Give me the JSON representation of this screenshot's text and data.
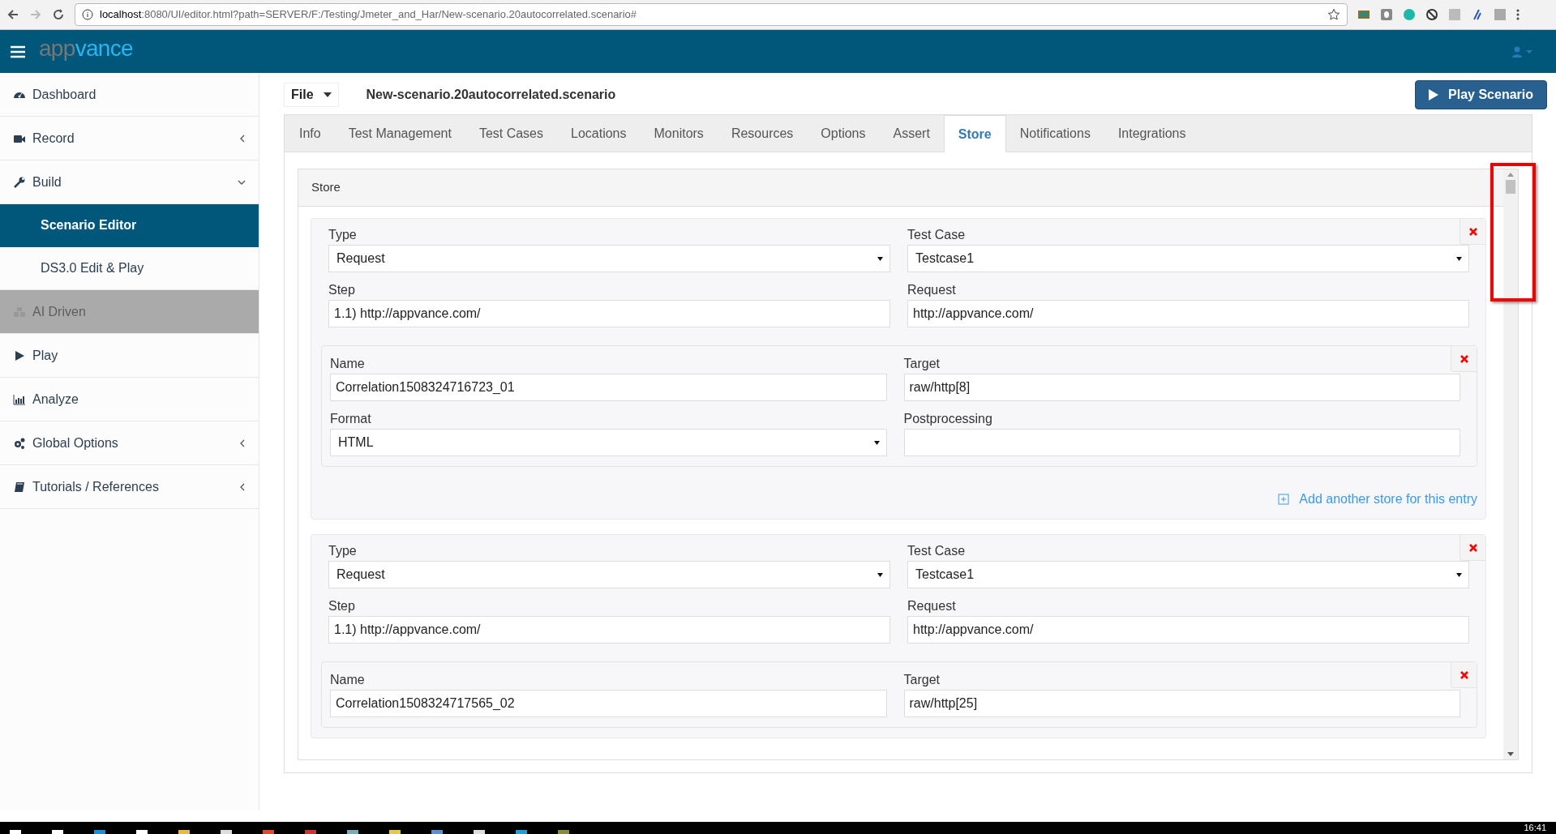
{
  "browser": {
    "url_host": "localhost",
    "url_rest": ":8080/UI/editor.html?path=SERVER/F:/Testing/Jmeter_and_Har/New-scenario.20autocorrelated.scenario#"
  },
  "header": {
    "logo_parts": [
      "app",
      "vance"
    ]
  },
  "sidebar": {
    "items": [
      {
        "label": "Dashboard",
        "kind": "dashboard",
        "has_submenu": false,
        "disabled": false
      },
      {
        "label": "Record",
        "kind": "video",
        "has_submenu": true,
        "expanded": false,
        "disabled": false
      },
      {
        "label": "Build",
        "kind": "wrench",
        "has_submenu": true,
        "disabled": false,
        "expanded": true,
        "children": [
          {
            "label": "Scenario Editor",
            "selected": true
          },
          {
            "label": "DS3.0 Edit & Play",
            "selected": false
          }
        ]
      },
      {
        "label": "AI Driven",
        "kind": "cubes",
        "has_submenu": false,
        "disabled": true
      },
      {
        "label": "Play",
        "kind": "play",
        "has_submenu": false,
        "disabled": false
      },
      {
        "label": "Analyze",
        "kind": "chart",
        "has_submenu": false,
        "disabled": false
      },
      {
        "label": "Global Options",
        "kind": "gears",
        "has_submenu": true,
        "expanded": false,
        "disabled": false
      },
      {
        "label": "Tutorials / References",
        "kind": "book",
        "has_submenu": true,
        "expanded": false,
        "disabled": false
      }
    ]
  },
  "toolbar": {
    "file_menu": "File",
    "scenario_title": "New-scenario.20autocorrelated.scenario",
    "play_button": "Play Scenario"
  },
  "tabs": [
    {
      "label": "Info",
      "selected": false
    },
    {
      "label": "Test Management",
      "selected": false
    },
    {
      "label": "Test Cases",
      "selected": false
    },
    {
      "label": "Locations",
      "selected": false
    },
    {
      "label": "Monitors",
      "selected": false
    },
    {
      "label": "Resources",
      "selected": false
    },
    {
      "label": "Options",
      "selected": false
    },
    {
      "label": "Assert",
      "selected": false
    },
    {
      "label": "Store",
      "selected": true
    },
    {
      "label": "Notifications",
      "selected": false
    },
    {
      "label": "Integrations",
      "selected": false
    }
  ],
  "store_panel": {
    "title": "Store",
    "entries": [
      {
        "fields": [
          {
            "label": "Type",
            "kind": "select",
            "value": "Request"
          },
          {
            "label": "Test Case",
            "kind": "select",
            "value": "Testcase1"
          },
          {
            "label": "Step",
            "kind": "input",
            "value": "1.1) http://appvance.com/"
          },
          {
            "label": "Request",
            "kind": "input",
            "value": "http://appvance.com/"
          }
        ],
        "stores": [
          {
            "fields": [
              {
                "label": "Name",
                "kind": "input",
                "value": "Correlation1508324716723_01"
              },
              {
                "label": "Target",
                "kind": "input",
                "value": "raw/http[8]"
              },
              {
                "label": "Format",
                "kind": "select",
                "value": "HTML"
              },
              {
                "label": "Postprocessing",
                "kind": "input"
              }
            ]
          }
        ],
        "add_link": "Add another store for this entry"
      },
      {
        "fields": [
          {
            "label": "Type",
            "kind": "select",
            "value": "Request"
          },
          {
            "label": "Test Case",
            "kind": "select",
            "value": "Testcase1"
          },
          {
            "label": "Step",
            "kind": "input",
            "value": "1.1) http://appvance.com/"
          },
          {
            "label": "Request",
            "kind": "input",
            "value": "http://appvance.com/"
          }
        ],
        "stores": [
          {
            "fields": [
              {
                "label": "Name",
                "kind": "input",
                "value": "Correlation1508324717565_02"
              },
              {
                "label": "Target",
                "kind": "input",
                "value": "raw/http[25]"
              }
            ]
          }
        ]
      }
    ]
  },
  "taskbar": {
    "time": "16:41"
  }
}
